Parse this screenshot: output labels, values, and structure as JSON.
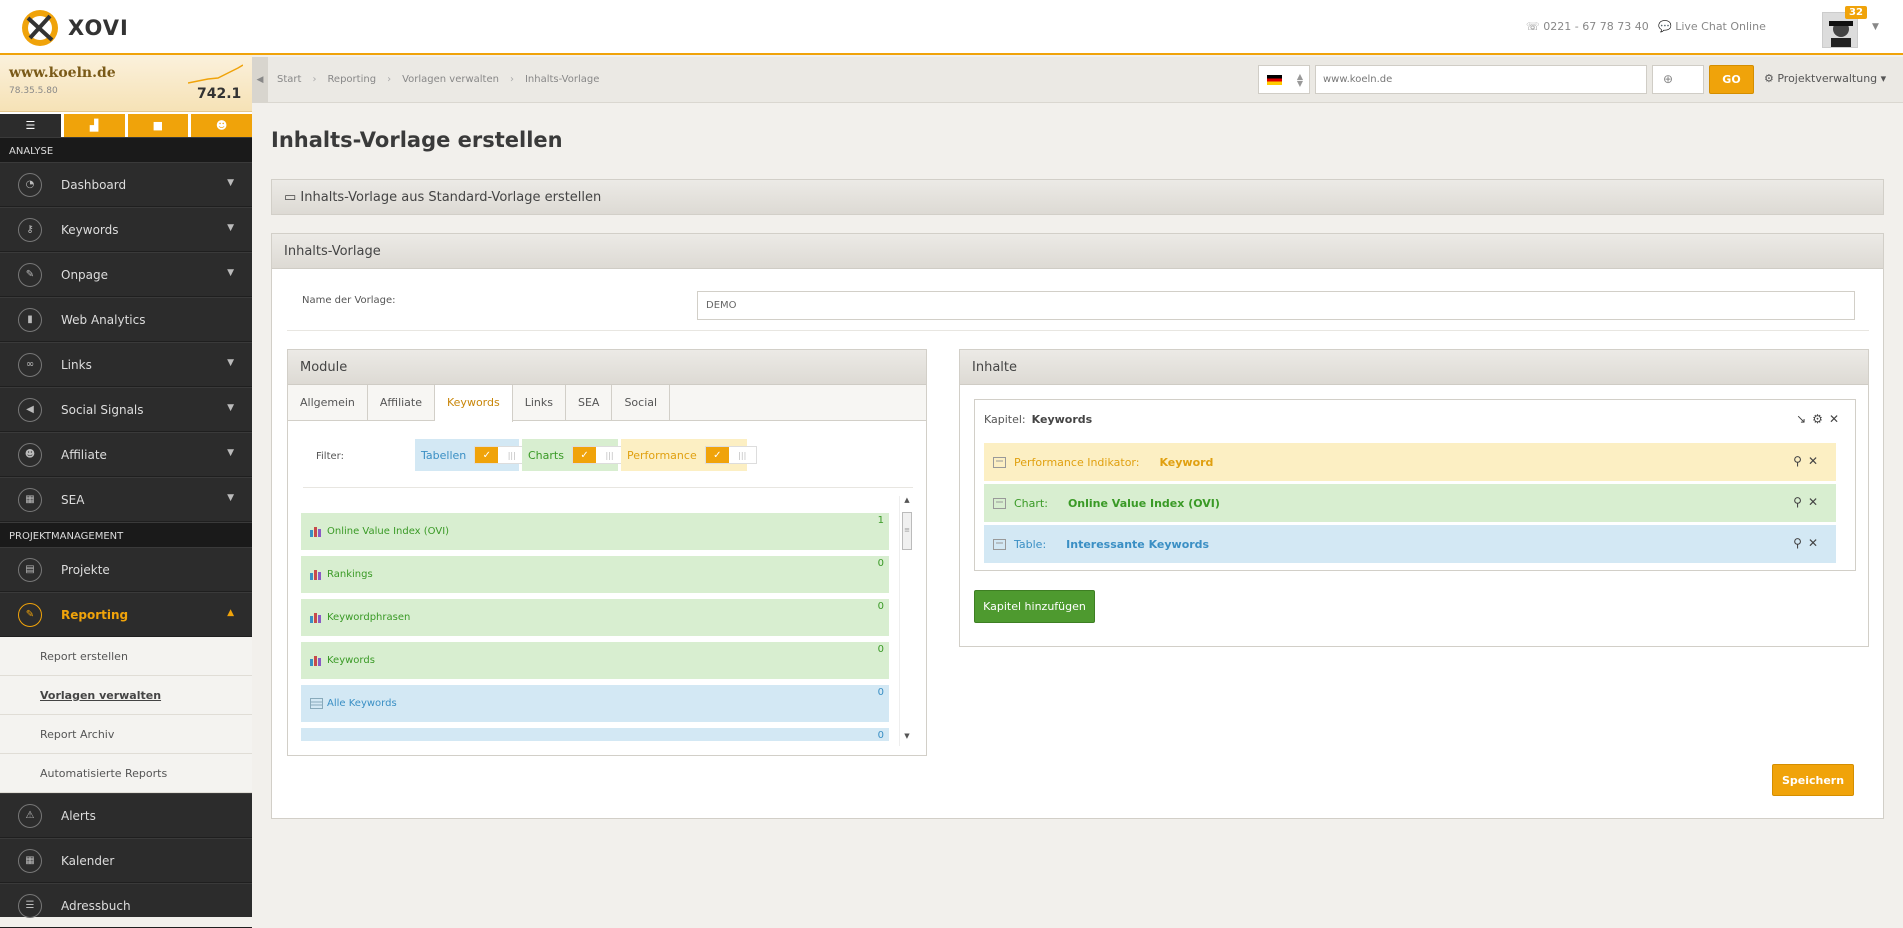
{
  "header": {
    "logo_text": "XOVI",
    "phone": "0221 - 67 78 73 40",
    "chat": "Live Chat Online",
    "notification_count": "32"
  },
  "project": {
    "name": "www.koeln.de",
    "ip": "78.35.5.80",
    "value": "742.1"
  },
  "sidebar": {
    "section_analyse": "ANALYSE",
    "section_pm": "PROJEKTMANAGEMENT",
    "analyse_items": [
      {
        "label": "Dashboard",
        "icon": "gauge-icon",
        "has_chevron": true
      },
      {
        "label": "Keywords",
        "icon": "key-icon",
        "has_chevron": true
      },
      {
        "label": "Onpage",
        "icon": "wrench-icon",
        "has_chevron": true
      },
      {
        "label": "Web Analytics",
        "icon": "bars-icon",
        "has_chevron": false
      },
      {
        "label": "Links",
        "icon": "link-icon",
        "has_chevron": true
      },
      {
        "label": "Social Signals",
        "icon": "megaphone-icon",
        "has_chevron": true
      },
      {
        "label": "Affiliate",
        "icon": "people-icon",
        "has_chevron": true
      },
      {
        "label": "SEA",
        "icon": "cash-register-icon",
        "has_chevron": true
      }
    ],
    "pm_items": [
      {
        "label": "Projekte"
      },
      {
        "label": "Reporting"
      }
    ],
    "reporting_sub": [
      "Report erstellen",
      "Vorlagen verwalten",
      "Report Archiv",
      "Automatisierte Reports"
    ],
    "bottom_items": [
      "Alerts",
      "Kalender",
      "Adressbuch"
    ]
  },
  "topnav": {
    "breadcrumbs": [
      "Start",
      "Reporting",
      "Vorlagen verwalten",
      "Inhalts-Vorlage"
    ],
    "url_value": "www.koeln.de",
    "go_label": "GO",
    "project_menu": "Projektverwaltung"
  },
  "main": {
    "title": "Inhalts-Vorlage erstellen",
    "std_panel_title": "Inhalts-Vorlage aus Standard-Vorlage erstellen",
    "tpl_panel_title": "Inhalts-Vorlage",
    "name_label": "Name der Vorlage:",
    "name_value": "DEMO",
    "save_label": "Speichern"
  },
  "modules": {
    "title": "Module",
    "tabs": [
      "Allgemein",
      "Affiliate",
      "Keywords",
      "Links",
      "SEA",
      "Social"
    ],
    "active_tab": "Keywords",
    "filter_label": "Filter:",
    "filters": [
      "Tabellen",
      "Charts",
      "Performance"
    ],
    "items": [
      {
        "label": "Online Value Index (OVI)",
        "count": "1",
        "kind": "chart"
      },
      {
        "label": "Rankings",
        "count": "0",
        "kind": "chart"
      },
      {
        "label": "Keywordphrasen",
        "count": "0",
        "kind": "chart"
      },
      {
        "label": "Keywords",
        "count": "0",
        "kind": "chart"
      },
      {
        "label": "Alle Keywords",
        "count": "0",
        "kind": "table"
      },
      {
        "label": "",
        "count": "0",
        "kind": "table"
      }
    ]
  },
  "contents": {
    "title": "Inhalte",
    "chapter_label": "Kapitel:",
    "chapter_name": "Keywords",
    "rows": [
      {
        "type": "Performance Indikator:",
        "name": "Keyword",
        "kind": "yellow"
      },
      {
        "type": "Chart:",
        "name": "Online Value Index (OVI)",
        "kind": "green"
      },
      {
        "type": "Table:",
        "name": "Interessante Keywords",
        "kind": "blue"
      }
    ],
    "add_chapter": "Kapitel hinzufügen"
  },
  "colors": {
    "accent": "#f0a30a",
    "sidebar_bg": "#2c2c2c",
    "green": "#4e9a2f"
  }
}
